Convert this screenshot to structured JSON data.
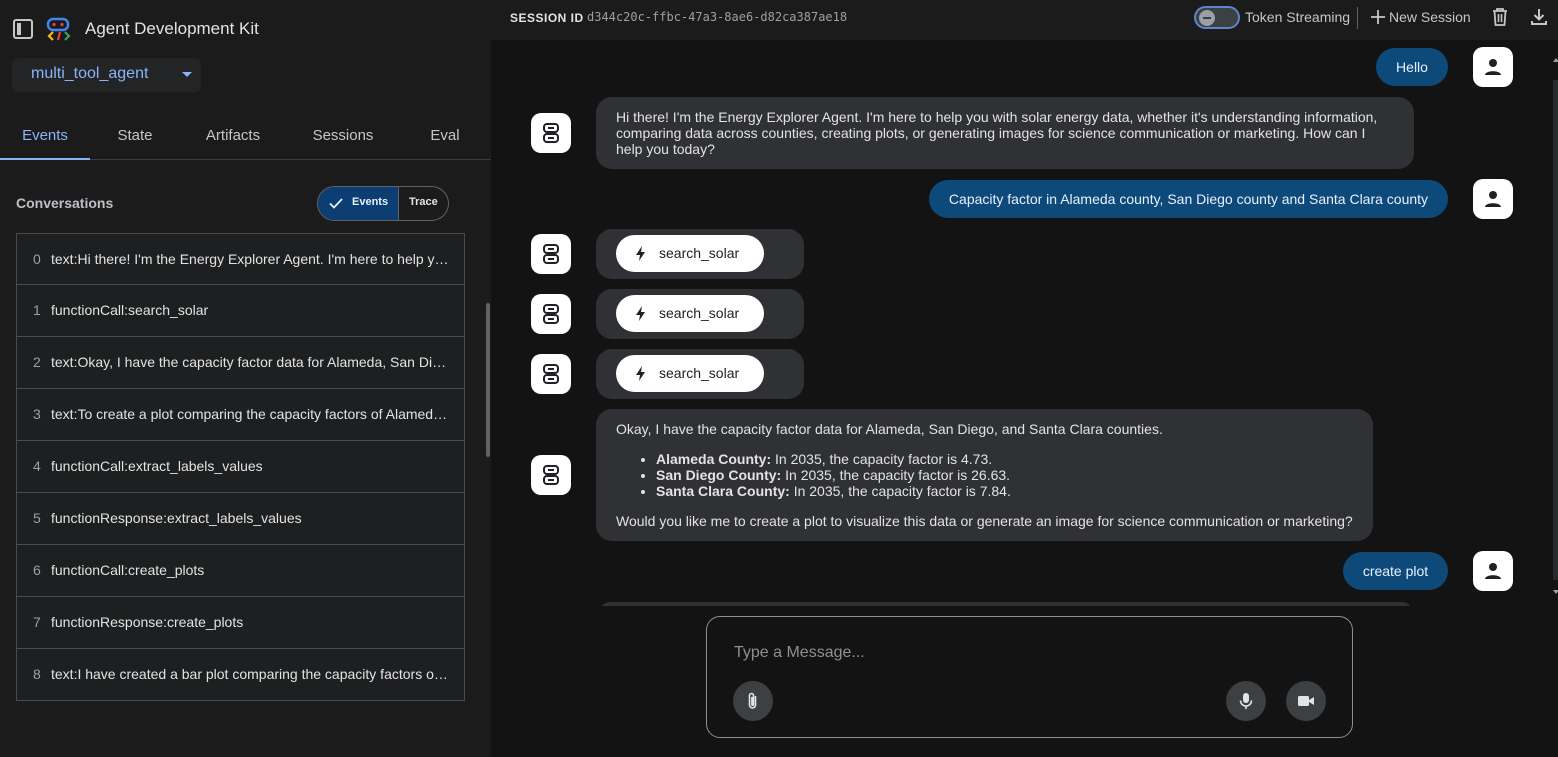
{
  "app": {
    "title": "Agent Development Kit",
    "agent_name": "multi_tool_agent"
  },
  "tabs": [
    "Events",
    "State",
    "Artifacts",
    "Sessions",
    "Eval"
  ],
  "conversations": {
    "label": "Conversations",
    "toggle_events": "Events",
    "toggle_trace": "Trace",
    "events": [
      {
        "index": "0",
        "text": "text:Hi there! I'm the Energy Explorer Agent. I'm here to help you with solar energy data"
      },
      {
        "index": "1",
        "text": "functionCall:search_solar"
      },
      {
        "index": "2",
        "text": "text:Okay, I have the capacity factor data for Alameda, San Diego, and Santa Clara counties."
      },
      {
        "index": "3",
        "text": "text:To create a plot comparing the capacity factors of Alameda, San Diego, and Santa Clara"
      },
      {
        "index": "4",
        "text": "functionCall:extract_labels_values"
      },
      {
        "index": "5",
        "text": "functionResponse:extract_labels_values"
      },
      {
        "index": "6",
        "text": "functionCall:create_plots"
      },
      {
        "index": "7",
        "text": "functionResponse:create_plots"
      },
      {
        "index": "8",
        "text": "text:I have created a bar plot comparing the capacity factors of Alameda, San Diego"
      }
    ]
  },
  "topbar": {
    "session_label": "SESSION ID",
    "session_id": "d344c20c-ffbc-47a3-8ae6-d82ca387ae18",
    "token_streaming_label": "Token Streaming",
    "new_session_label": "New Session"
  },
  "chat": {
    "user_hello": "Hello",
    "agent_greeting": "Hi there! I'm the Energy Explorer Agent. I'm here to help you with solar energy data, whether it's understanding information, comparing data across counties, creating plots, or generating images for science communication or marketing. How can I help you today?",
    "user_query": "Capacity factor in Alameda county, San Diego county and Santa Clara county",
    "function_name": "search_solar",
    "agent_result": {
      "intro": "Okay, I have the capacity factor data for Alameda, San Diego, and Santa Clara counties.",
      "items": [
        {
          "county": "Alameda County:",
          "detail": " In 2035, the capacity factor is 4.73."
        },
        {
          "county": "San Diego County:",
          "detail": " In 2035, the capacity factor is 26.63."
        },
        {
          "county": "Santa Clara County:",
          "detail": " In 2035, the capacity factor is 7.84."
        }
      ],
      "outro": "Would you like me to create a plot to visualize this data or generate an image for science communication or marketing?"
    },
    "user_plot": "create plot"
  },
  "input": {
    "placeholder": "Type a Message..."
  },
  "colors": {
    "accent": "#8ab4f8",
    "user_bubble": "#0d4a7a",
    "agent_bubble": "#303134",
    "background": "#131314",
    "sidebar": "#1b1b1c"
  }
}
